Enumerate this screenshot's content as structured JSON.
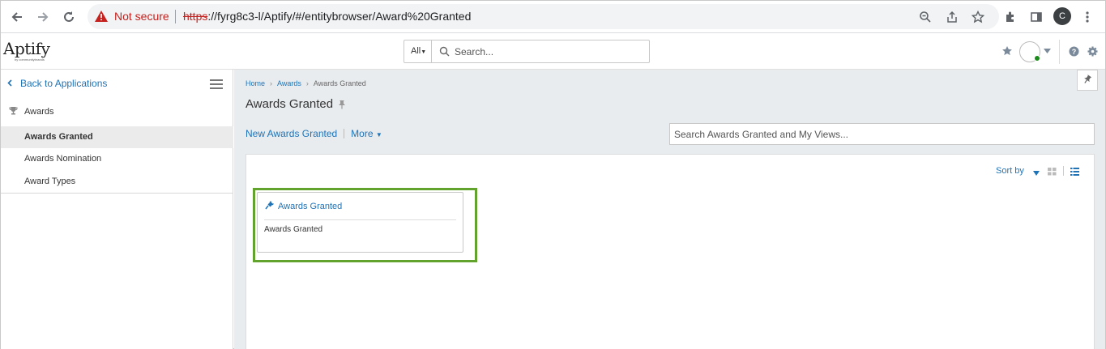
{
  "browser": {
    "security_label": "Not secure",
    "url_scheme": "https",
    "url_rest": "://fyrg8c3-l/Aptify/#/entitybrowser/Award%20Granted",
    "profile_initial": "C"
  },
  "header": {
    "logo_text": "Aptify",
    "logo_sub": "by communitybrands",
    "search_scope": "All",
    "search_placeholder": "Search..."
  },
  "sidebar": {
    "back_label": "Back to Applications",
    "group_label": "Awards",
    "items": [
      {
        "label": "Awards Granted",
        "active": true
      },
      {
        "label": "Awards Nomination",
        "active": false
      },
      {
        "label": "Award Types",
        "active": false
      }
    ]
  },
  "main": {
    "breadcrumb": [
      "Home",
      "Awards",
      "Awards Granted"
    ],
    "title": "Awards Granted",
    "new_action": "New Awards Granted",
    "more_action": "More",
    "views_search_placeholder": "Search Awards Granted and My Views...",
    "sort_label": "Sort by",
    "card": {
      "title": "Awards Granted",
      "body": "Awards Granted"
    }
  },
  "colors": {
    "link": "#1f73b7",
    "highlight": "#62a32e",
    "warning": "#c5221f"
  }
}
